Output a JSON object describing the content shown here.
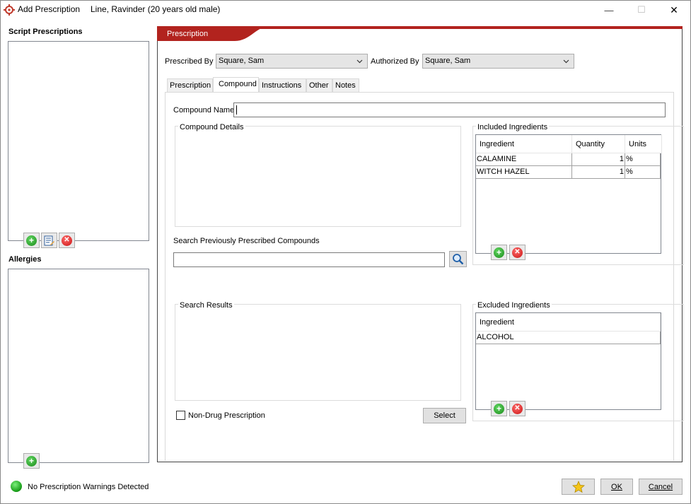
{
  "window": {
    "title": "Add Prescription",
    "patient": "Line, Ravinder (20 years old male)",
    "minimize_glyph": "—",
    "maximize_glyph": "☐",
    "close_glyph": "✕"
  },
  "left": {
    "script_prescriptions_title": "Script Prescriptions",
    "allergies_title": "Allergies"
  },
  "prescription_panel": {
    "header": "Prescription",
    "prescribed_by_label": "Prescribed By",
    "prescribed_by_value": "Square, Sam",
    "authorized_by_label": "Authorized By",
    "authorized_by_value": "Square, Sam",
    "tabs": [
      "Prescription",
      "Compound",
      "Instructions",
      "Other",
      "Notes"
    ],
    "active_tab": "Compound"
  },
  "compound": {
    "name_label": "Compound Name",
    "name_value": "",
    "details_label": "Compound Details",
    "search_label": "Search Previously Prescribed Compounds",
    "search_value": "",
    "results_label": "Search Results",
    "non_drug_label": "Non-Drug Prescription",
    "non_drug_checked": false,
    "select_label": "Select",
    "included": {
      "title": "Included Ingredients",
      "headers": [
        "Ingredient",
        "Quantity",
        "Units"
      ],
      "rows": [
        {
          "ingredient": "CALAMINE",
          "quantity": "1",
          "units": "%"
        },
        {
          "ingredient": "WITCH HAZEL",
          "quantity": "1",
          "units": "%"
        }
      ]
    },
    "excluded": {
      "title": "Excluded Ingredients",
      "headers": [
        "Ingredient"
      ],
      "rows": [
        {
          "ingredient": "ALCOHOL"
        }
      ]
    }
  },
  "footer": {
    "status": "No Prescription Warnings Detected",
    "ok_label": "OK",
    "cancel_label": "Cancel"
  },
  "colors": {
    "accent_red": "#b2231e",
    "status_green": "#22b422"
  }
}
